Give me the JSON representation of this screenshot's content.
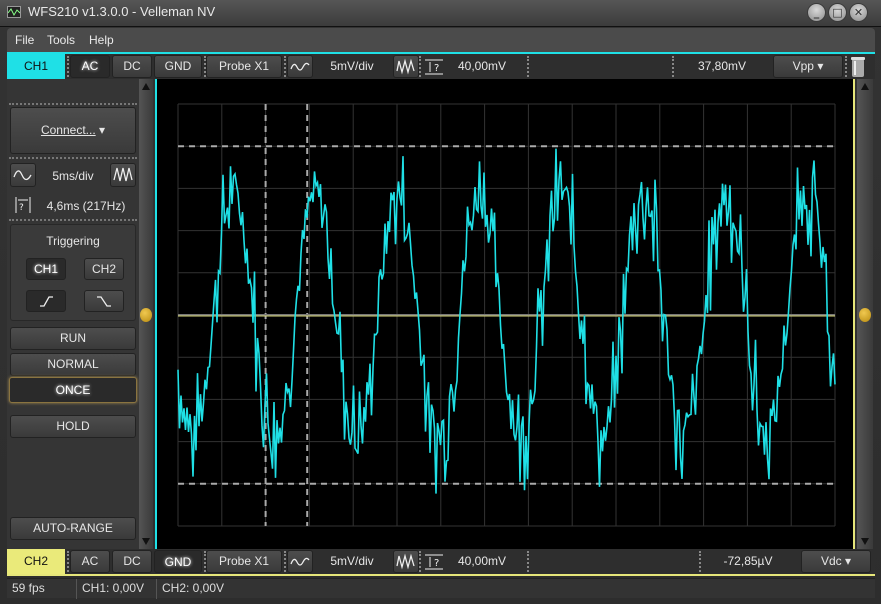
{
  "window": {
    "title": "WFS210 v1.3.0.0 - Velleman NV",
    "buttons": {
      "minimize": "_",
      "maximize": "□",
      "close": "✕"
    }
  },
  "menu": [
    "File",
    "Tools",
    "Help"
  ],
  "ch1": {
    "label": "CH1",
    "color": "#1fe0e6",
    "coupling": [
      "AC",
      "DC",
      "GND"
    ],
    "active_coupling": "AC",
    "probe": "Probe X1",
    "volts_div": "5mV/div",
    "marker_value": "40,00mV",
    "measurement": "37,80mV",
    "measure_mode": "Vpp"
  },
  "ch2": {
    "label": "CH2",
    "color": "#eaea7a",
    "coupling": [
      "AC",
      "DC",
      "GND"
    ],
    "active_coupling": "GND",
    "probe": "Probe X1",
    "volts_div": "5mV/div",
    "marker_value": "40,00mV",
    "measurement": "-72,85µV",
    "measure_mode": "Vdc"
  },
  "left_panel": {
    "connect": "Connect...",
    "time_div": "5ms/div",
    "time_marker": "4,6ms (217Hz)",
    "triggering": {
      "title": "Triggering",
      "channels": [
        "CH1",
        "CH2"
      ],
      "active_channel": "CH1",
      "slopes": [
        "rising",
        "falling"
      ],
      "active_slope": "rising"
    },
    "modes": [
      "RUN",
      "NORMAL",
      "ONCE"
    ],
    "active_mode": "ONCE",
    "hold": "HOLD",
    "auto_range": "AUTO-RANGE"
  },
  "scope": {
    "grid": {
      "columns": 15,
      "rows": 10
    },
    "time_cursors_div": [
      2.0,
      2.95
    ],
    "voltage_cursors_div": [
      4.0,
      -4.0
    ],
    "ch1_trace": "noisy sine, ~4.6ms period, ~±3div amplitude",
    "ch2_trace": "flat at 0V"
  },
  "status": {
    "fps": "59 fps",
    "ch1": "CH1: 0,00V",
    "ch2": "CH2: 0,00V"
  }
}
